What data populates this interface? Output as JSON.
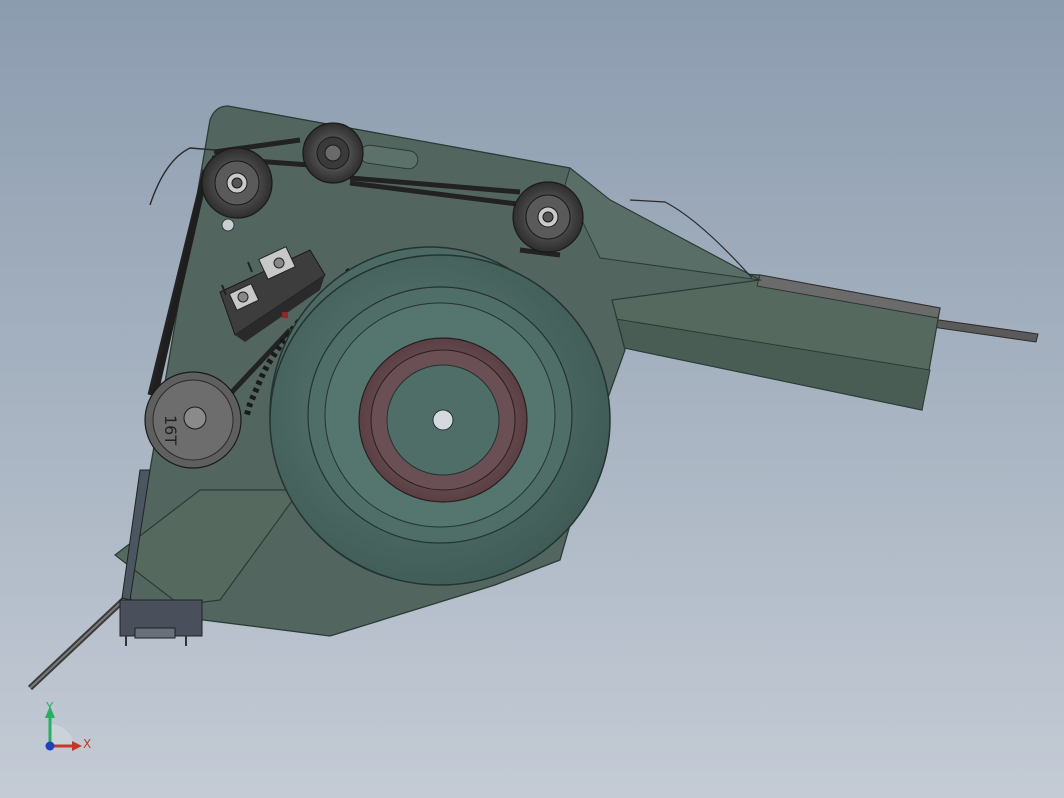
{
  "view": {
    "background_top": "#8c9caf",
    "background_bottom": "#c4cbd5",
    "body_color": "#52665f",
    "body_edge_color": "#2c3a36",
    "reel_color": "#4f6e68",
    "hub_color": "#6e5458",
    "roller_color": "#555555",
    "belt_color": "#2a2a2a"
  },
  "part": {
    "roller_engraving": "16T"
  },
  "triad": {
    "x_label": "X",
    "y_label": "Y",
    "x_color": "#c0392b",
    "y_color": "#27ae60",
    "z_color": "#1f3fbf"
  }
}
